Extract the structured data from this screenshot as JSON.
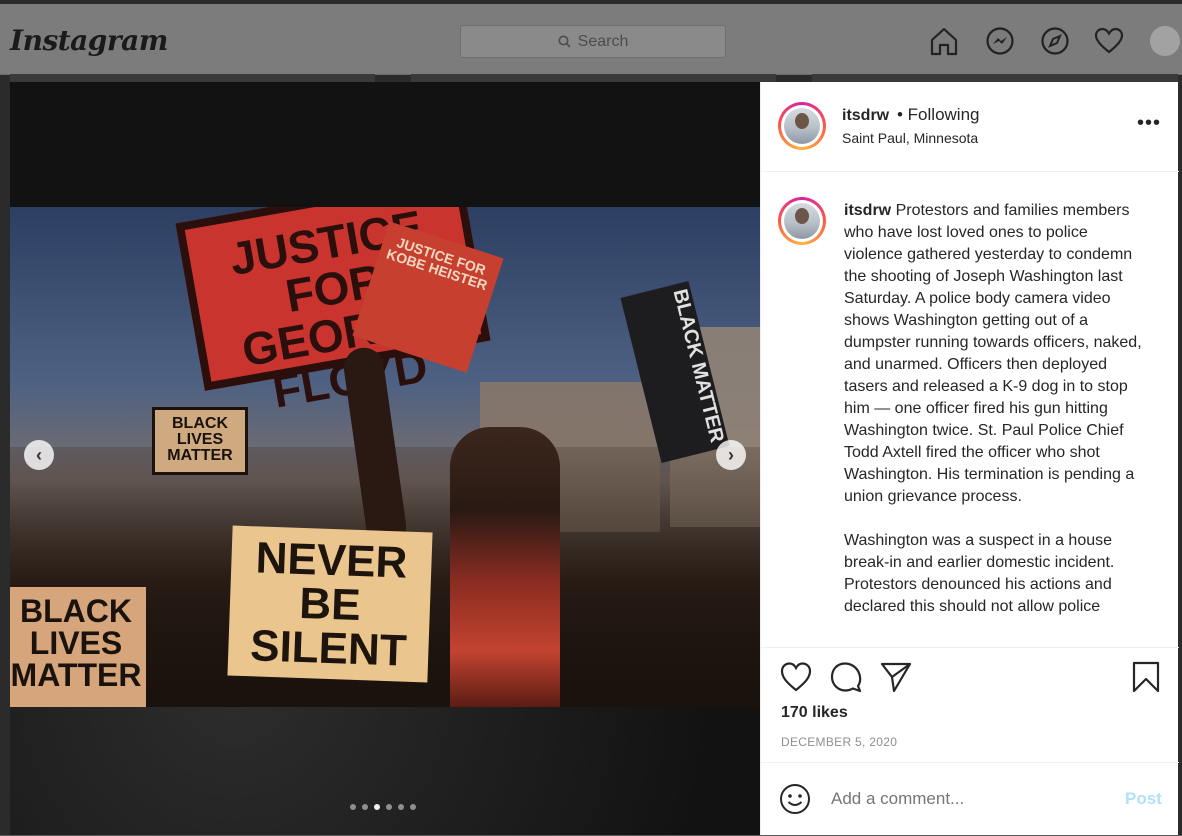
{
  "header": {
    "logo": "Instagram",
    "search_placeholder": "Search",
    "icons": [
      "home-icon",
      "messenger-icon",
      "explore-icon",
      "heart-icon",
      "profile-avatar"
    ]
  },
  "post": {
    "username": "itsdrw",
    "follow_status": "• Following",
    "location": "Saint Paul, Minnesota",
    "more_label": "•••",
    "caption_username": "itsdrw",
    "caption_p1": "Protestors and families members who have lost loved ones to police violence gathered yesterday to condemn the shooting of Joseph Washington last Saturday. A police body camera video shows Washington getting out of a dumpster running towards officers, naked, and unarmed. Officers then deployed tasers and released a K-9 dog in to stop him — one officer fired his gun hitting Washington twice. St. Paul Police Chief Todd Axtell fired the officer who shot Washington. His termination is pending a union grievance process.",
    "caption_p2": "Washington was a suspect in a house break-in and earlier domestic incident. Protestors denounced his actions and declared this should not allow police",
    "likes": "170 likes",
    "date": "DECEMBER 5, 2020",
    "comment_placeholder": "Add a comment...",
    "post_label": "Post",
    "carousel_count": 6,
    "carousel_active_index": 2
  },
  "photo_signs": {
    "george": "JUSTICE FOR GEORGE FLOYD",
    "kobe": "JUSTICE FOR KOBE HEISTER",
    "never": "NEVER BE SILENT",
    "blm_left": "BLACK LIVES MATTER",
    "blm_mid": "BLACK LIVES MATTER",
    "flag": "BLACK MATTER"
  },
  "colors": {
    "accent_blue_disabled": "#b2dffc",
    "text": "#262626",
    "muted": "#8e8e8e"
  }
}
